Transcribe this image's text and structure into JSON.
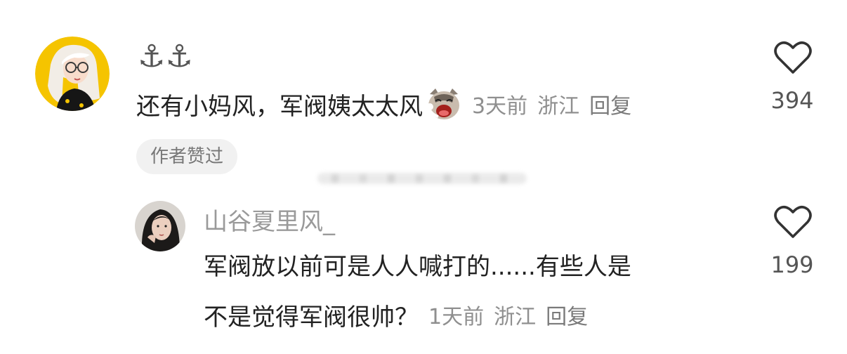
{
  "main_comment": {
    "username": "⚓⚓",
    "text": "还有小妈风，军阀姨太太风",
    "emoji": "crying-cat-emoji",
    "time": "3天前",
    "location": "浙江",
    "reply_label": "回复",
    "likes": "394",
    "author_liked_badge": "作者赞过"
  },
  "reply": {
    "username": "山谷夏里风_",
    "text_line1": "军阀放以前可是人人喊打的......有些人是",
    "text_line2": "不是觉得军阀很帅？",
    "time": "1天前",
    "location": "浙江",
    "reply_label": "回复",
    "likes": "199"
  },
  "icons": {
    "like": "heart-outline-icon"
  },
  "colors": {
    "primary_text": "#222222",
    "meta_text": "#8f8f8f",
    "badge_bg": "#f1f1f1",
    "avatar_bg": "#f5c400"
  }
}
